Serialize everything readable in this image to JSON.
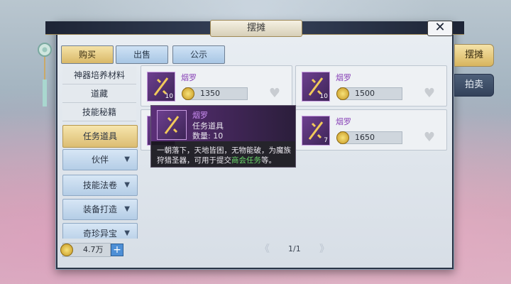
{
  "window": {
    "title": "摆摊",
    "close_label": "✕"
  },
  "top_tabs": [
    "购买",
    "出售",
    "公示"
  ],
  "side_tabs": [
    "摆摊",
    "拍卖"
  ],
  "categories": {
    "sub_items": [
      "神器培养材料",
      "道藏",
      "技能秘籍"
    ],
    "selected": "任务道具",
    "groups": [
      "伙伴",
      "技能法卷",
      "装备打造",
      "奇珍异宝"
    ],
    "group_arrow": "▼"
  },
  "items": [
    {
      "name": "烟罗",
      "count": "10",
      "price": "1350"
    },
    {
      "name": "烟罗",
      "count": "10",
      "price": "1500"
    },
    {
      "name": "烟罗",
      "count": "",
      "price": ""
    },
    {
      "name": "烟罗",
      "count": "7",
      "price": "1650"
    }
  ],
  "tooltip": {
    "name": "烟罗",
    "type": "任务道具",
    "quantity": "数量: 10",
    "desc_before": "一朝落下，天地皆困，无物能破，为魔族狩猎圣器，可用于提交",
    "desc_highlight": "商会任务",
    "desc_after": "等。"
  },
  "footer": {
    "money": "4.7万",
    "plus": "+",
    "page": "1/1",
    "prev": "《",
    "next": "》"
  },
  "colors": {
    "accent_gold": "#d9b867",
    "item_name_purple": "#8a46b8",
    "highlight_green": "#6ddc6d"
  }
}
